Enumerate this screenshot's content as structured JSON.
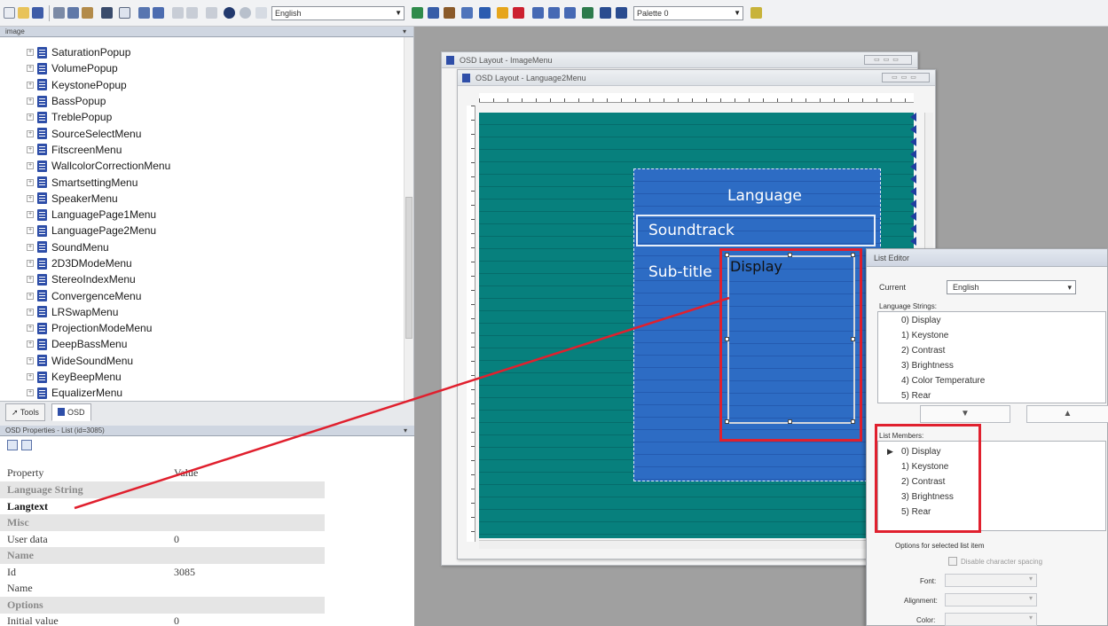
{
  "toolbar": {
    "language_combo": "English",
    "palette_combo": "Palette 0",
    "icons": [
      "new-icon",
      "open-icon",
      "save-icon",
      "cut-icon",
      "copy-icon",
      "paste-icon",
      "pointer-icon",
      "grid-icon",
      "help-icon",
      "whatsthis-icon",
      "undo-icon",
      "redo-icon",
      "close-icon",
      "globe-icon",
      "settings-icon",
      "text-icon"
    ]
  },
  "tree": {
    "header": "image",
    "items": [
      "SaturationPopup",
      "VolumePopup",
      "KeystonePopup",
      "BassPopup",
      "TreblePopup",
      "SourceSelectMenu",
      "FitscreenMenu",
      "WallcolorCorrectionMenu",
      "SmartsettingMenu",
      "SpeakerMenu",
      "LanguagePage1Menu",
      "LanguagePage2Menu",
      "SoundMenu",
      "2D3DModeMenu",
      "StereoIndexMenu",
      "ConvergenceMenu",
      "LRSwapMenu",
      "ProjectionModeMenu",
      "DeepBassMenu",
      "WideSoundMenu",
      "KeyBeepMenu",
      "EqualizerMenu"
    ]
  },
  "tabs": [
    {
      "label": "Tools"
    },
    {
      "label": "OSD"
    }
  ],
  "properties": {
    "header": "OSD Properties - List (id=3085)",
    "column_property": "Property",
    "column_value": "Value",
    "rows": [
      {
        "key": "Language String",
        "value": "",
        "type": "cat"
      },
      {
        "key": "Langtext",
        "value": "",
        "type": "bold"
      },
      {
        "key": "Misc",
        "value": "",
        "type": "cat"
      },
      {
        "key": "User data",
        "value": "0",
        "type": "row"
      },
      {
        "key": "Name",
        "value": "",
        "type": "cat"
      },
      {
        "key": "Id",
        "value": "3085",
        "type": "row"
      },
      {
        "key": "Name",
        "value": "",
        "type": "row"
      },
      {
        "key": "Options",
        "value": "",
        "type": "cat"
      },
      {
        "key": "Initial value",
        "value": "0",
        "type": "row"
      }
    ]
  },
  "windows": {
    "back_title": "OSD Layout - ImageMenu",
    "front_title": "OSD Layout - Language2Menu"
  },
  "osd": {
    "title": "Language",
    "item_soundtrack": "Soundtrack",
    "item_subtitle": "Sub-title",
    "list_value": "Display"
  },
  "list_editor": {
    "title": "List Editor",
    "current_label": "Current",
    "current_value": "English",
    "language_strings_label": "Language Strings:",
    "language_strings": [
      "0) Display",
      "1) Keystone",
      "2) Contrast",
      "3) Brightness",
      "4) Color Temperature",
      "5) Rear"
    ],
    "list_members_label": "List Members:",
    "list_members": [
      "0) Display",
      "1) Keystone",
      "2) Contrast",
      "3) Brightness",
      "5) Rear"
    ],
    "down_button": "▼",
    "up_button": "▲",
    "options_label": "Options for selected list item",
    "disable_spacing_label": "Disable character spacing",
    "font_label": "Font:",
    "alignment_label": "Alignment:",
    "color_label": "Color:"
  },
  "colors": {
    "highlight": "#e0202e",
    "canvas_teal": "#07807d",
    "osd_blue": "#2d6cc4"
  }
}
